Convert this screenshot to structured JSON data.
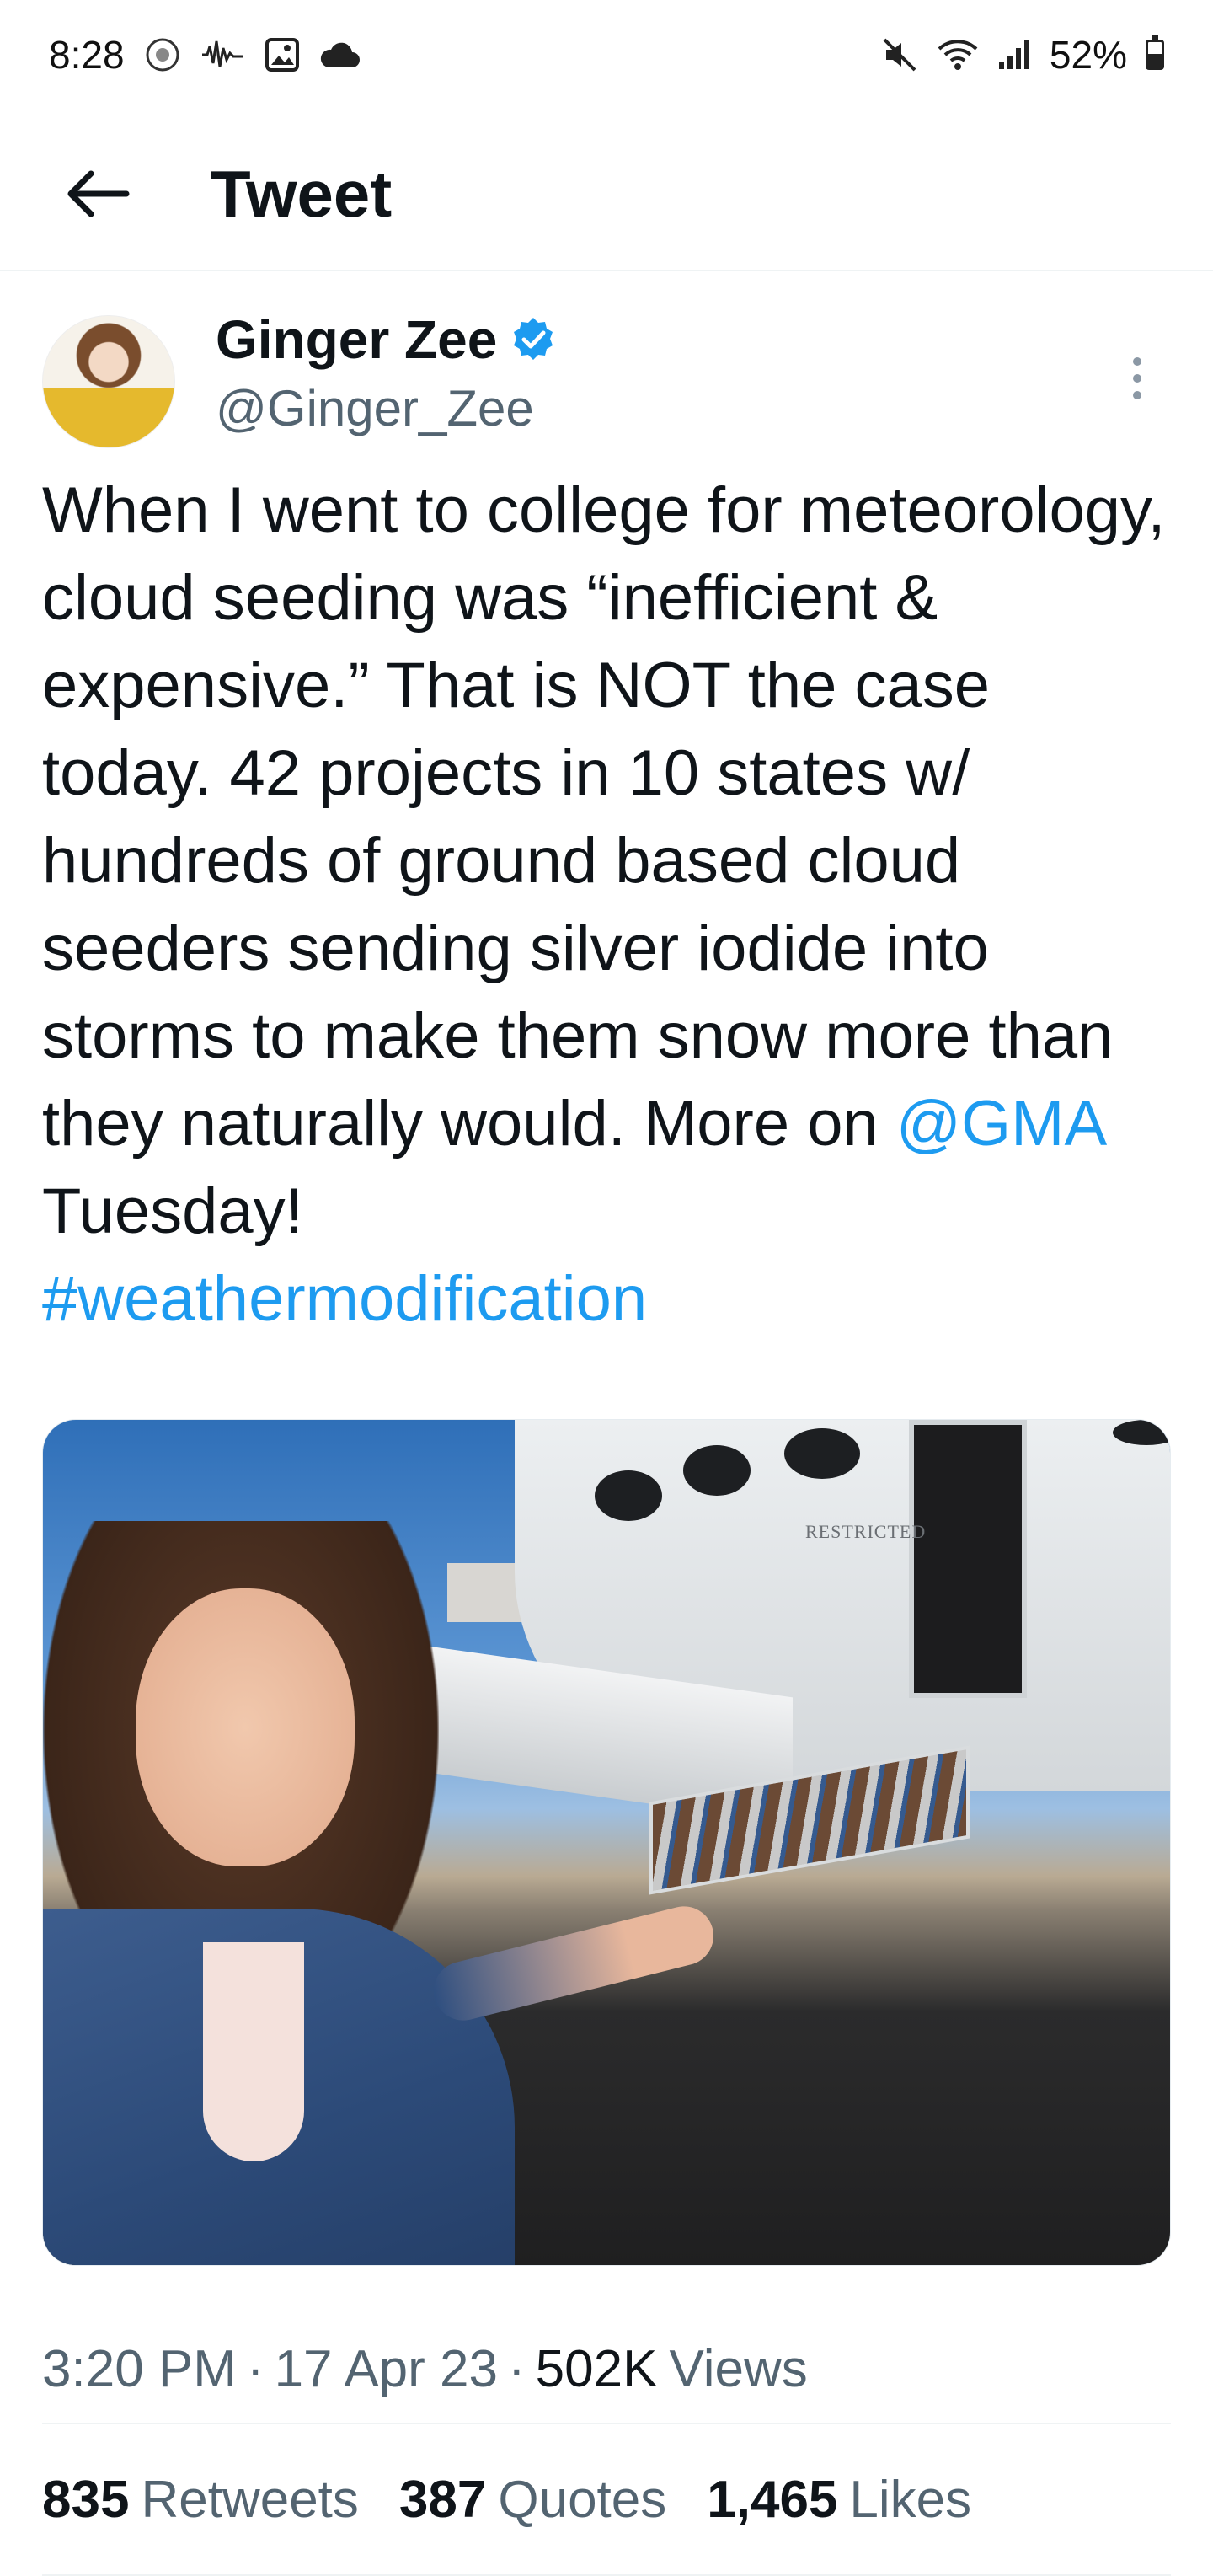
{
  "status_bar": {
    "time": "8:28",
    "battery_percent": "52%",
    "icons_left": [
      "app-badge-icon",
      "waveform-icon",
      "image-icon",
      "cloud-icon"
    ],
    "icons_right": [
      "mute-icon",
      "wifi-icon",
      "signal-icon",
      "battery-icon"
    ]
  },
  "header": {
    "title": "Tweet"
  },
  "tweet": {
    "author_name": "Ginger Zee",
    "author_handle": "@Ginger_Zee",
    "verified": true,
    "text_main": "When I went to college for meteorology, cloud seeding was “inefficient & expensive.” That is NOT the case today. 42 projects in 10 states w/ hundreds of ground based cloud seeders sending silver iodide into storms to make them snow more than they naturally would. More on ",
    "mention": "@GMA",
    "text_after_mention": " Tuesday!",
    "hashtag": "#weathermodification",
    "media_caption_text": "RESTRICTED",
    "time": "3:20 PM",
    "date": "17 Apr 23",
    "views_count": "502K",
    "views_label": "Views",
    "separator": "·",
    "stats": {
      "retweets_count": "835",
      "retweets_label": "Retweets",
      "quotes_count": "387",
      "quotes_label": "Quotes",
      "likes_count": "1,465",
      "likes_label": "Likes"
    }
  },
  "colors": {
    "link": "#1d9bf0",
    "text_primary": "#0f1419",
    "text_secondary": "#536471",
    "divider": "#eff3f4"
  }
}
